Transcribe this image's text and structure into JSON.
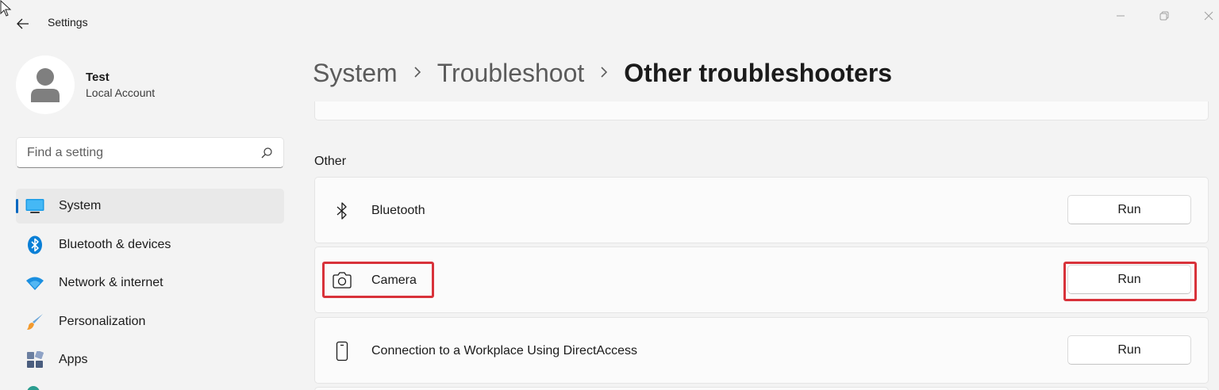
{
  "window": {
    "title": "Settings"
  },
  "user": {
    "name": "Test",
    "account_type": "Local Account"
  },
  "search": {
    "placeholder": "Find a setting"
  },
  "sidebar": {
    "items": [
      {
        "label": "System",
        "icon": "monitor-icon",
        "active": true
      },
      {
        "label": "Bluetooth & devices",
        "icon": "bluetooth-icon",
        "active": false
      },
      {
        "label": "Network & internet",
        "icon": "wifi-icon",
        "active": false
      },
      {
        "label": "Personalization",
        "icon": "brush-icon",
        "active": false
      },
      {
        "label": "Apps",
        "icon": "apps-icon",
        "active": false
      }
    ]
  },
  "breadcrumb": {
    "items": [
      "System",
      "Troubleshoot"
    ],
    "current": "Other troubleshooters"
  },
  "section": {
    "title": "Other"
  },
  "troubleshooters": [
    {
      "label": "Bluetooth",
      "icon": "bluetooth-icon",
      "button": "Run",
      "highlighted": false
    },
    {
      "label": "Camera",
      "icon": "camera-icon",
      "button": "Run",
      "highlighted": true
    },
    {
      "label": "Connection to a Workplace Using DirectAccess",
      "icon": "phone-icon",
      "button": "Run",
      "highlighted": false
    }
  ],
  "colors": {
    "accent": "#0067c0",
    "highlight": "#d8323a",
    "background": "#f3f3f3",
    "card": "#fbfbfb"
  }
}
